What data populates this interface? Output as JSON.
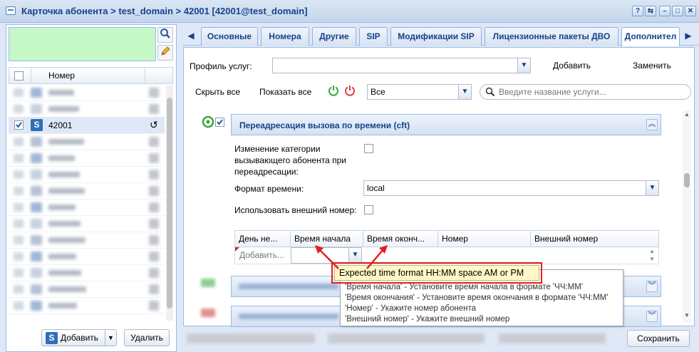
{
  "window": {
    "title": "Карточка абонента > test_domain > 42001 [42001@test_domain]",
    "tools": [
      "?",
      "⇆",
      "–",
      "□",
      "✕"
    ]
  },
  "left": {
    "column_header": "Номер",
    "selected_row": "42001",
    "add_button": "Добавить",
    "delete_button": "Удалить"
  },
  "tabs": [
    "Основные",
    "Номера",
    "Другие",
    "SIP",
    "Модификации SIP",
    "Лицензионные пакеты ДВО",
    "Дополнител"
  ],
  "form": {
    "profile_label": "Профиль услуг:",
    "profile_value": "",
    "add_label": "Добавить",
    "replace_label": "Заменить",
    "collapse_all": "Скрыть все",
    "show_all": "Показать все",
    "filter_value": "Все",
    "search_placeholder": "Введите название услуги..."
  },
  "section": {
    "title": "Переадресация вызова по времени (cft)",
    "change_category_label": "Изменение категории вызывающего абонента при переадресации:",
    "time_format_label": "Формат времени:",
    "time_format_value": "local",
    "external_number_label": "Использовать внешний номер:"
  },
  "table": {
    "columns": [
      "День не...",
      "Время начала",
      "Время оконч...",
      "Номер",
      "Внешний номер"
    ],
    "add_placeholder": "Добавить..."
  },
  "tooltip": {
    "warning": "Expected time format HH:MM space AM or PM",
    "lines": [
      "'Время начала' - Установите время начала в формате 'ЧЧ:ММ'",
      "'Время окончания' - Установите время окончания в формате 'ЧЧ:ММ'",
      "'Номер' - Укажите номер абонента",
      "'Внешний номер' - Укажите внешний номер"
    ]
  },
  "footer": {
    "save_button": "Сохранить"
  },
  "colors": {
    "accent": "#15428b",
    "highlight_red": "#e0201e",
    "tooltip_bg": "#fff7c8",
    "power_on": "#3aa53a",
    "power_off": "#e04040"
  }
}
